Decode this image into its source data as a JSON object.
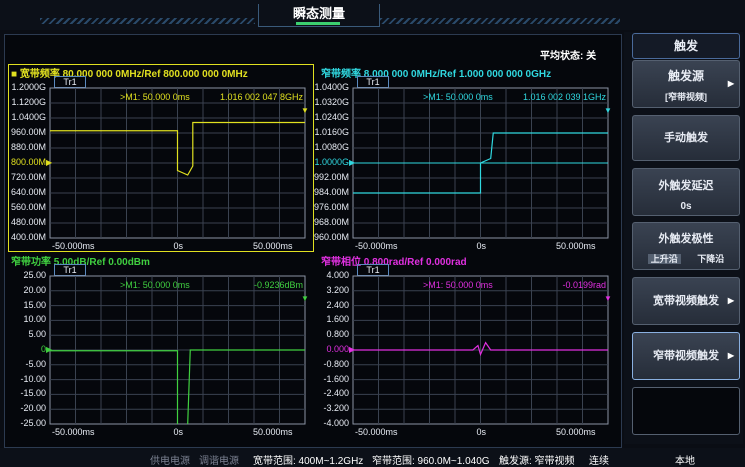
{
  "title": "瞬态测量",
  "avg_status": "平均状态: 关",
  "panels": [
    {
      "name": "wideband-freq",
      "title": "■ 宽带频率 80.000 000 0MHz/Ref 800.000 000 0MHz",
      "trace_label": "Tr1",
      "marker_label": ">M1: 50.000 0ms",
      "marker_value": "1.016 002 047 8GHz",
      "y_ticks": [
        "1.2000G",
        "1.1200G",
        "1.0400G",
        "960.00M",
        "880.00M",
        "800.00M",
        "720.00M",
        "640.00M",
        "560.00M",
        "480.00M",
        "400.00M"
      ],
      "ref_tick": "800.00M",
      "x_ticks": [
        "-50.000ms",
        "0s",
        "50.000ms"
      ],
      "color": "#e0e020",
      "active": true
    },
    {
      "name": "narrowband-freq",
      "title": "窄带频率 8.000 000 0MHz/Ref 1.000 000 000 0GHz",
      "trace_label": "Tr1",
      "marker_label": ">M1: 50.000 0ms",
      "marker_value": "1.016 002 039 1GHz",
      "y_ticks": [
        "1.0400G",
        "1.0320G",
        "1.0240G",
        "1.0160G",
        "1.0080G",
        "1.0000G",
        "992.00M",
        "984.00M",
        "976.00M",
        "968.00M",
        "960.00M"
      ],
      "ref_tick": "1.0000G",
      "x_ticks": [
        "-50.000ms",
        "0s",
        "50.000ms"
      ],
      "color": "#30d8e0",
      "active": false
    },
    {
      "name": "narrowband-power",
      "title": "窄带功率 5.00dB/Ref 0.00dBm",
      "trace_label": "Tr1",
      "marker_label": ">M1: 50.000 0ms",
      "marker_value": "-0.9236dBm",
      "y_ticks": [
        "25.00",
        "20.00",
        "15.00",
        "10.00",
        "5.00",
        "0",
        "-5.00",
        "-10.00",
        "-15.00",
        "-20.00",
        "-25.00"
      ],
      "ref_tick": "0",
      "x_ticks": [
        "-50.000ms",
        "0s",
        "50.000ms"
      ],
      "color": "#40d040",
      "active": false
    },
    {
      "name": "narrowband-phase",
      "title": "窄带相位 0.800rad/Ref 0.000rad",
      "trace_label": "Tr1",
      "marker_label": ">M1: 50.000 0ms",
      "marker_value": "-0.0199rad",
      "y_ticks": [
        "4.000",
        "3.200",
        "2.400",
        "1.600",
        "0.800",
        "0.000",
        "-0.800",
        "-1.600",
        "-2.400",
        "-3.200",
        "-4.000"
      ],
      "ref_tick": "0.000",
      "x_ticks": [
        "-50.000ms",
        "0s",
        "50.000ms"
      ],
      "color": "#e030e0",
      "active": false
    }
  ],
  "menu": {
    "header": "触发",
    "trigger_source": {
      "label": "触发源",
      "value": "[窄带视频]"
    },
    "manual_trigger": "手动触发",
    "ext_delay": {
      "label": "外触发延迟",
      "value": "0s"
    },
    "ext_polarity": {
      "label": "外触发极性",
      "rising": "上升沿",
      "falling": "下降沿"
    },
    "wideband_video": "宽带视频触发",
    "narrowband_video": "窄带视频触发"
  },
  "status": {
    "power_supply": "供电电源",
    "tuning_supply": "调谐电源",
    "wide_range": "宽带范围: 400M~1.2GHz",
    "narrow_range": "窄带范围: 960.0M~1.040G",
    "trigger_source": "触发源: 窄带视频",
    "mode": "连续",
    "location": "本地"
  },
  "colors": {
    "accent_green": "#3cd070",
    "panel_border": "#2c3a50"
  }
}
